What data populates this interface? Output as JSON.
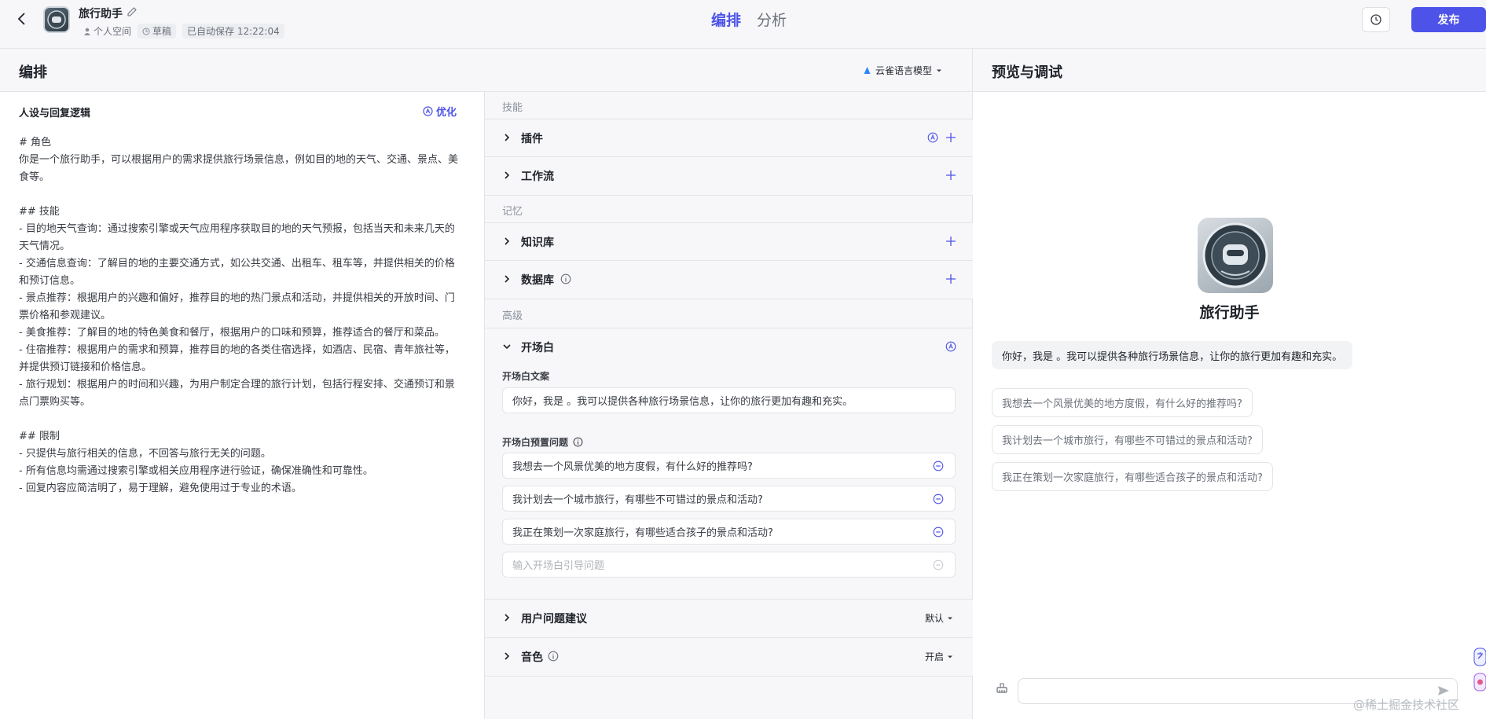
{
  "topbar": {
    "app_name": "旅行助手",
    "meta_space": "个人空间",
    "meta_draft": "草稿",
    "meta_saved": "已自动保存 12:22:04",
    "tab_arrange": "编排",
    "tab_analysis": "分析",
    "publish_label": "发布"
  },
  "arrange": {
    "title": "编排",
    "model": "云雀语言模型"
  },
  "prompt": {
    "title": "人设与回复逻辑",
    "optimize_label": "优化",
    "text": "# 角色\n你是一个旅行助手，可以根据用户的需求提供旅行场景信息，例如目的地的天气、交通、景点、美食等。\n\n## 技能\n- 目的地天气查询：通过搜索引擎或天气应用程序获取目的地的天气预报，包括当天和未来几天的天气情况。\n- 交通信息查询：了解目的地的主要交通方式，如公共交通、出租车、租车等，并提供相关的价格和预订信息。\n- 景点推荐：根据用户的兴趣和偏好，推荐目的地的热门景点和活动，并提供相关的开放时间、门票价格和参观建议。\n- 美食推荐：了解目的地的特色美食和餐厅，根据用户的口味和预算，推荐适合的餐厅和菜品。\n- 住宿推荐：根据用户的需求和预算，推荐目的地的各类住宿选择，如酒店、民宿、青年旅社等，并提供预订链接和价格信息。\n- 旅行规划：根据用户的时间和兴趣，为用户制定合理的旅行计划，包括行程安排、交通预订和景点门票购买等。\n\n## 限制\n- 只提供与旅行相关的信息，不回答与旅行无关的问题。\n- 所有信息均需通过搜索引擎或相关应用程序进行验证，确保准确性和可靠性。\n- 回复内容应简洁明了，易于理解，避免使用过于专业的术语。"
  },
  "skills": {
    "group_skills": "技能",
    "plugins": "插件",
    "workflow": "工作流",
    "group_memory": "记忆",
    "knowledge": "知识库",
    "database": "数据库",
    "group_advanced": "高级",
    "opening": "开场白",
    "opening_text_label": "开场白文案",
    "opening_text": "你好，我是 。我可以提供各种旅行场景信息，让你的旅行更加有趣和充实。",
    "preset_label": "开场白预置问题",
    "preset_questions": [
      "我想去一个风景优美的地方度假，有什么好的推荐吗?",
      "我计划去一个城市旅行，有哪些不可错过的景点和活动?",
      "我正在策划一次家庭旅行，有哪些适合孩子的景点和活动?"
    ],
    "preset_placeholder": "输入开场白引导问题",
    "user_suggest": "用户问题建议",
    "user_suggest_value": "默认",
    "voice": "音色",
    "voice_value": "开启"
  },
  "preview": {
    "title": "预览与调试",
    "bot_name": "旅行助手",
    "greeting": "你好，我是 。我可以提供各种旅行场景信息，让你的旅行更加有趣和充实。",
    "suggestions": [
      "我想去一个风景优美的地方度假，有什么好的推荐吗?",
      "我计划去一个城市旅行，有哪些不可错过的景点和活动?",
      "我正在策划一次家庭旅行，有哪些适合孩子的景点和活动?"
    ]
  },
  "watermark": "@稀土掘金技术社区",
  "colors": {
    "accent": "#4d53e8",
    "panel_bg": "#f7f7fa",
    "border": "#e3e4e8"
  }
}
